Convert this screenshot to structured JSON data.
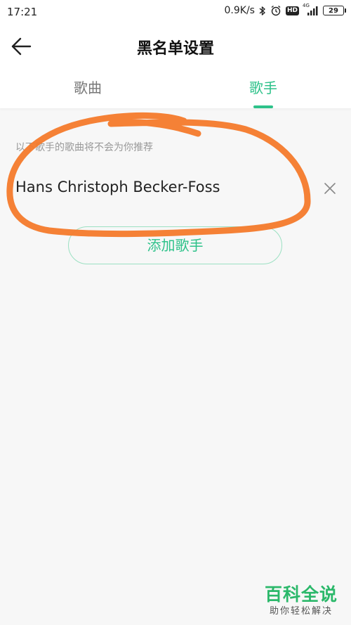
{
  "status_bar": {
    "time": "17:21",
    "network_speed": "0.9K/s",
    "hd_label": "HD",
    "signal_label": "4G",
    "battery_level": "29",
    "icons": [
      "bluetooth-icon",
      "alarm-icon",
      "hd-icon",
      "signal-icon",
      "battery-icon"
    ]
  },
  "header": {
    "title": "黑名单设置",
    "back_icon": "arrow-left-icon"
  },
  "tabs": [
    {
      "label": "歌曲",
      "active": false
    },
    {
      "label": "歌手",
      "active": true
    }
  ],
  "blacklist": {
    "hint": "以下歌手的歌曲将不会为你推荐",
    "artists": [
      {
        "name": "Hans Christoph Becker-Foss",
        "remove_icon": "close-icon"
      }
    ],
    "add_button_label": "添加歌手"
  },
  "watermark": {
    "title": "百科全说",
    "subtitle": "助你轻松解决"
  },
  "colors": {
    "accent": "#2ec28a",
    "annotation": "#f47a2b",
    "watermark": "#2bb86a"
  }
}
